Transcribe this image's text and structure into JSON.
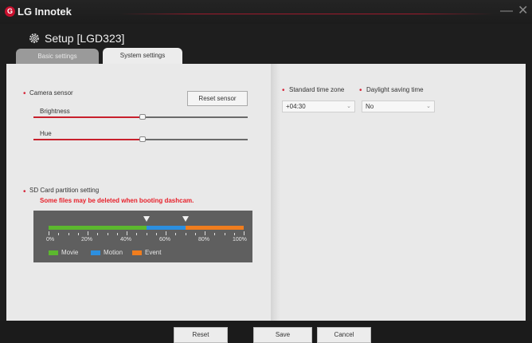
{
  "window": {
    "app_title": "LG Innotek",
    "logo_glyph": "G",
    "minimize_glyph": "—",
    "close_glyph": "✕"
  },
  "header": {
    "title": "Setup [LGD323]",
    "icon": "gear-icon"
  },
  "tabs": [
    {
      "label": "Basic settings",
      "active": false
    },
    {
      "label": "System settings",
      "active": true
    }
  ],
  "camera_sensor": {
    "label": "Camera sensor",
    "reset_label": "Reset sensor",
    "brightness": {
      "label": "Brightness",
      "value_fraction": 0.51
    },
    "hue": {
      "label": "Hue",
      "value_fraction": 0.51
    }
  },
  "sd_card": {
    "label": "SD Card partition setting",
    "warning": "Some files may be deleted when booting dashcam.",
    "ticks": [
      "0%",
      "20%",
      "40%",
      "60%",
      "80%",
      "100%"
    ],
    "partitions": [
      {
        "name": "Movie",
        "percent": 50,
        "color": "#5cb82e"
      },
      {
        "name": "Motion",
        "percent": 20,
        "color": "#2c8fe0"
      },
      {
        "name": "Event",
        "percent": 30,
        "color": "#f07d1e"
      }
    ]
  },
  "time": {
    "timezone_label": "Standard time zone",
    "timezone_value": "+04:30",
    "dst_label": "Daylight saving time",
    "dst_value": "No"
  },
  "footer": {
    "reset_label": "Reset",
    "save_label": "Save",
    "cancel_label": "Cancel"
  },
  "colors": {
    "accent_red": "#d6263a",
    "slider_red": "#c8202c",
    "warning_red": "#e8202a"
  }
}
